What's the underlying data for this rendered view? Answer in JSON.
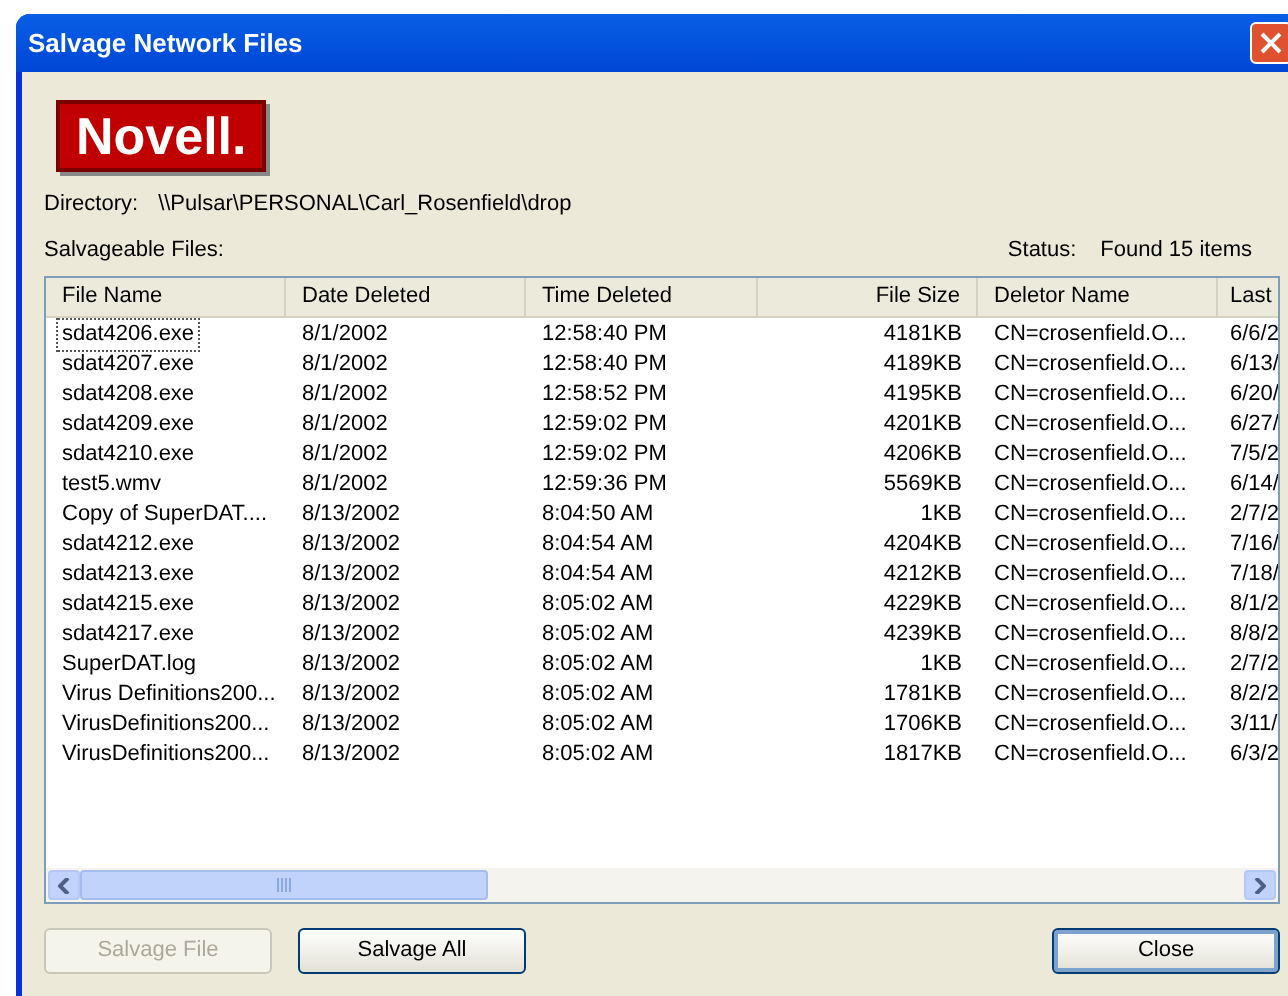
{
  "window": {
    "title": "Salvage Network Files"
  },
  "logo": "Novell.",
  "directory": {
    "label": "Directory:",
    "value": "\\\\Pulsar\\PERSONAL\\Carl_Rosenfield\\drop"
  },
  "list_label": "Salvageable Files:",
  "status": {
    "label": "Status:",
    "value": "Found 15 items"
  },
  "table": {
    "columns": [
      "File Name",
      "Date Deleted",
      "Time Deleted",
      "File Size",
      "Deletor Name",
      "Last"
    ],
    "rows": [
      {
        "focused": true,
        "cells": [
          "sdat4206.exe",
          "8/1/2002",
          "12:58:40 PM",
          "4181KB",
          "CN=crosenfield.O...",
          "6/6/2"
        ]
      },
      {
        "focused": false,
        "cells": [
          "sdat4207.exe",
          "8/1/2002",
          "12:58:40 PM",
          "4189KB",
          "CN=crosenfield.O...",
          "6/13/"
        ]
      },
      {
        "focused": false,
        "cells": [
          "sdat4208.exe",
          "8/1/2002",
          "12:58:52 PM",
          "4195KB",
          "CN=crosenfield.O...",
          "6/20/"
        ]
      },
      {
        "focused": false,
        "cells": [
          "sdat4209.exe",
          "8/1/2002",
          "12:59:02 PM",
          "4201KB",
          "CN=crosenfield.O...",
          "6/27/"
        ]
      },
      {
        "focused": false,
        "cells": [
          "sdat4210.exe",
          "8/1/2002",
          "12:59:02 PM",
          "4206KB",
          "CN=crosenfield.O...",
          "7/5/2"
        ]
      },
      {
        "focused": false,
        "cells": [
          "test5.wmv",
          "8/1/2002",
          "12:59:36 PM",
          "5569KB",
          "CN=crosenfield.O...",
          "6/14/"
        ]
      },
      {
        "focused": false,
        "cells": [
          "Copy of SuperDAT....",
          "8/13/2002",
          "8:04:50 AM",
          "1KB",
          "CN=crosenfield.O...",
          "2/7/2"
        ]
      },
      {
        "focused": false,
        "cells": [
          "sdat4212.exe",
          "8/13/2002",
          "8:04:54 AM",
          "4204KB",
          "CN=crosenfield.O...",
          "7/16/"
        ]
      },
      {
        "focused": false,
        "cells": [
          "sdat4213.exe",
          "8/13/2002",
          "8:04:54 AM",
          "4212KB",
          "CN=crosenfield.O...",
          "7/18/"
        ]
      },
      {
        "focused": false,
        "cells": [
          "sdat4215.exe",
          "8/13/2002",
          "8:05:02 AM",
          "4229KB",
          "CN=crosenfield.O...",
          "8/1/2"
        ]
      },
      {
        "focused": false,
        "cells": [
          "sdat4217.exe",
          "8/13/2002",
          "8:05:02 AM",
          "4239KB",
          "CN=crosenfield.O...",
          "8/8/2"
        ]
      },
      {
        "focused": false,
        "cells": [
          "SuperDAT.log",
          "8/13/2002",
          "8:05:02 AM",
          "1KB",
          "CN=crosenfield.O...",
          "2/7/2"
        ]
      },
      {
        "focused": false,
        "cells": [
          "Virus Definitions200...",
          "8/13/2002",
          "8:05:02 AM",
          "1781KB",
          "CN=crosenfield.O...",
          "8/2/2"
        ]
      },
      {
        "focused": false,
        "cells": [
          "VirusDefinitions200...",
          "8/13/2002",
          "8:05:02 AM",
          "1706KB",
          "CN=crosenfield.O...",
          "3/11/"
        ]
      },
      {
        "focused": false,
        "cells": [
          "VirusDefinitions200...",
          "8/13/2002",
          "8:05:02 AM",
          "1817KB",
          "CN=crosenfield.O...",
          "6/3/2"
        ]
      }
    ]
  },
  "buttons": [
    {
      "label": "Salvage File",
      "disabled": true,
      "default": false
    },
    {
      "label": "Salvage All",
      "disabled": false,
      "default": false
    },
    {
      "label": "Close",
      "disabled": false,
      "default": true
    }
  ]
}
